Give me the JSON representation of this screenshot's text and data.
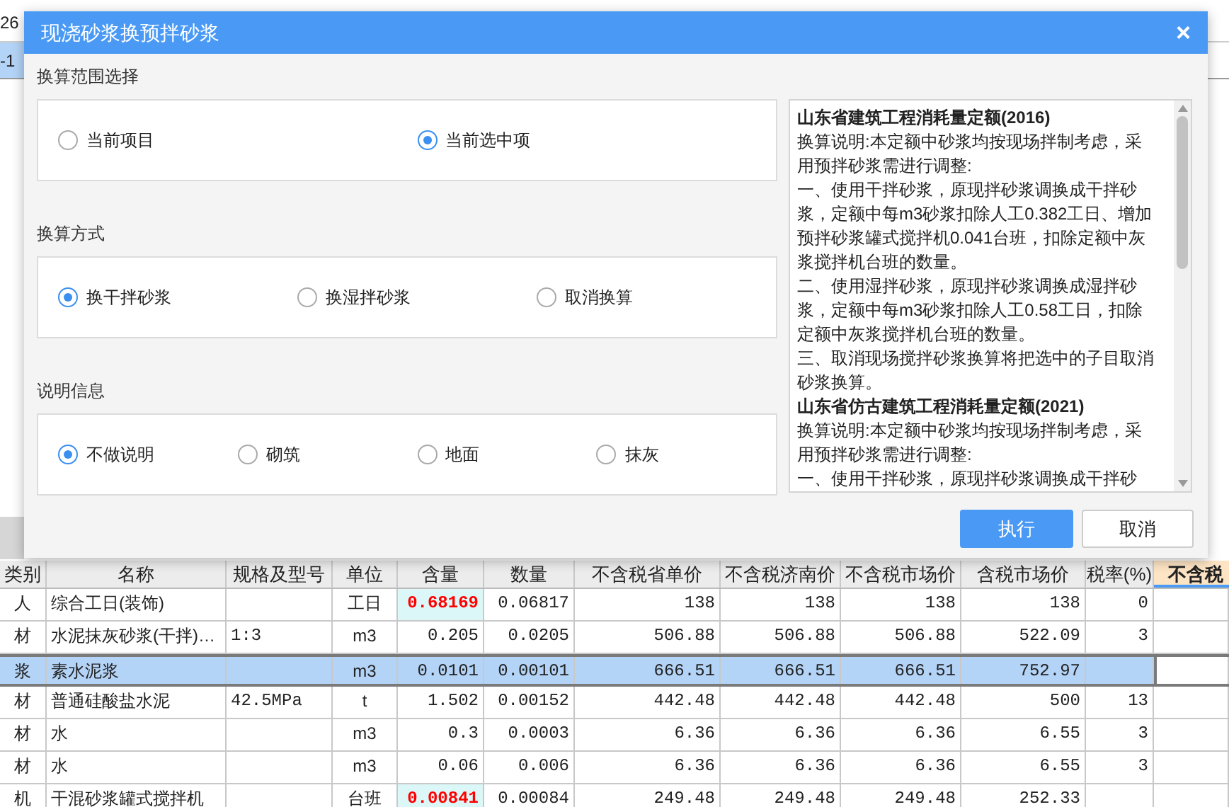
{
  "background": {
    "cell_1": "26",
    "cell_2": "-1"
  },
  "dialog": {
    "title": "现浇砂浆换预拌砂浆",
    "close": "×",
    "groups": [
      {
        "label": "换算范围选择",
        "options": [
          {
            "label": "当前项目",
            "selected": false
          },
          {
            "label": "当前选中项",
            "selected": true
          }
        ]
      },
      {
        "label": "换算方式",
        "options": [
          {
            "label": "换干拌砂浆",
            "selected": true
          },
          {
            "label": "换湿拌砂浆",
            "selected": false
          },
          {
            "label": "取消换算",
            "selected": false
          }
        ]
      },
      {
        "label": "说明信息",
        "options": [
          {
            "label": "不做说明",
            "selected": true
          },
          {
            "label": "砌筑",
            "selected": false
          },
          {
            "label": "地面",
            "selected": false
          },
          {
            "label": "抹灰",
            "selected": false
          }
        ]
      }
    ],
    "notes": [
      {
        "kind": "heading",
        "text": "山东省建筑工程消耗量定额(2016)"
      },
      {
        "kind": "text",
        "text": "换算说明:本定额中砂浆均按现场拌制考虑，采用预拌砂浆需进行调整:"
      },
      {
        "kind": "text",
        "text": "一、使用干拌砂浆，原现拌砂浆调换成干拌砂浆，定额中每m3砂浆扣除人工0.382工日、增加预拌砂浆罐式搅拌机0.041台班，扣除定额中灰浆搅拌机台班的数量。"
      },
      {
        "kind": "text",
        "text": "二、使用湿拌砂浆，原现拌砂浆调换成湿拌砂浆，定额中每m3砂浆扣除人工0.58工日，扣除定额中灰浆搅拌机台班的数量。"
      },
      {
        "kind": "text",
        "text": "三、取消现场搅拌砂浆换算将把选中的子目取消砂浆换算。"
      },
      {
        "kind": "heading",
        "text": "山东省仿古建筑工程消耗量定额(2021)"
      },
      {
        "kind": "text",
        "text": "换算说明:本定额中砂浆均按现场拌制考虑，采用预拌砂浆需进行调整:"
      },
      {
        "kind": "text",
        "text": "一、使用干拌砂浆，原现拌砂浆调换成干拌砂"
      }
    ],
    "buttons": [
      {
        "label": "执行",
        "kind": "primary"
      },
      {
        "label": "取消",
        "kind": "secondary"
      }
    ]
  },
  "table": {
    "columns": [
      "类别",
      "名称",
      "规格及型号",
      "单位",
      "含量",
      "数量",
      "不含税省单价",
      "不含税济南价",
      "不含税市场价",
      "含税市场价",
      "税率(%)",
      "不含税"
    ],
    "rows": [
      {
        "selected": false,
        "content_highlighted": true,
        "cells": [
          "人",
          "综合工日(装饰)",
          "",
          "工日",
          "0.68169",
          "0.06817",
          "138",
          "138",
          "138",
          "138",
          "0"
        ]
      },
      {
        "selected": false,
        "content_highlighted": false,
        "cells": [
          "材",
          "水泥抹灰砂浆(干拌)…",
          "1:3",
          "m3",
          "0.205",
          "0.0205",
          "506.88",
          "506.88",
          "506.88",
          "522.09",
          "3"
        ]
      },
      {
        "selected": true,
        "content_highlighted": false,
        "cells": [
          "浆",
          "素水泥浆",
          "",
          "m3",
          "0.0101",
          "0.00101",
          "666.51",
          "666.51",
          "666.51",
          "752.97",
          ""
        ]
      },
      {
        "selected": false,
        "content_highlighted": false,
        "cells": [
          "材",
          "普通硅酸盐水泥",
          "42.5MPa",
          "t",
          "1.502",
          "0.00152",
          "442.48",
          "442.48",
          "442.48",
          "500",
          "13"
        ]
      },
      {
        "selected": false,
        "content_highlighted": false,
        "cells": [
          "材",
          "水",
          "",
          "m3",
          "0.3",
          "0.0003",
          "6.36",
          "6.36",
          "6.36",
          "6.55",
          "3"
        ]
      },
      {
        "selected": false,
        "content_highlighted": false,
        "cells": [
          "材",
          "水",
          "",
          "m3",
          "0.06",
          "0.006",
          "6.36",
          "6.36",
          "6.36",
          "6.55",
          "3"
        ]
      },
      {
        "selected": false,
        "content_highlighted": true,
        "cells": [
          "机",
          "干混砂浆罐式搅拌机",
          "",
          "台班",
          "0.00841",
          "0.00084",
          "249.48",
          "249.48",
          "249.48",
          "252.33",
          ""
        ]
      }
    ]
  }
}
